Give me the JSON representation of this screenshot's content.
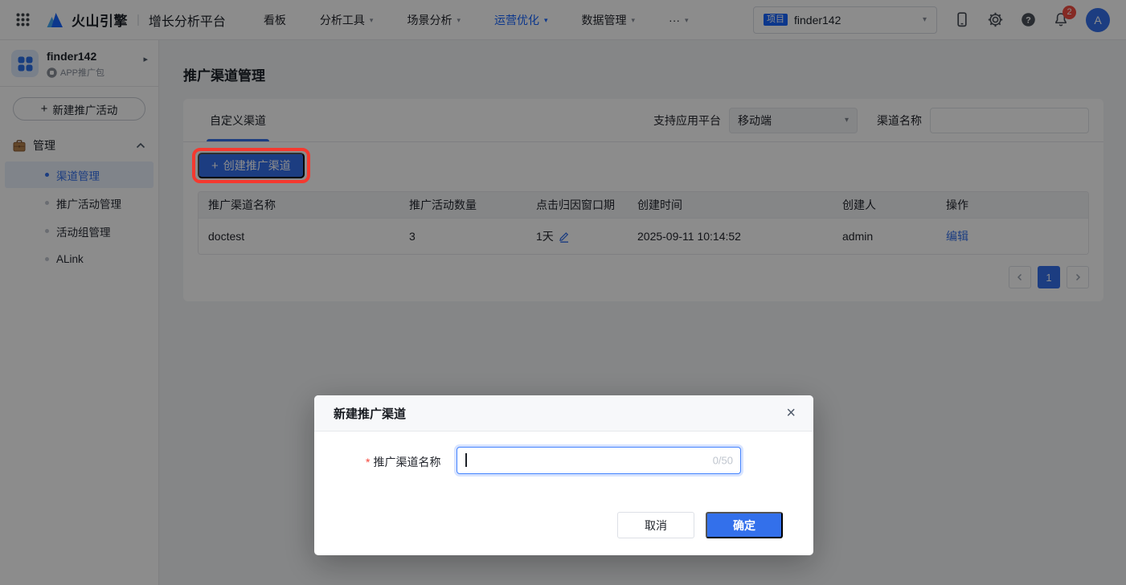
{
  "topbar": {
    "brand": "火山引擎",
    "product": "增长分析平台",
    "nav": [
      {
        "label": "看板"
      },
      {
        "label": "分析工具"
      },
      {
        "label": "场景分析"
      },
      {
        "label": "运营优化"
      },
      {
        "label": "数据管理"
      },
      {
        "label": "···"
      }
    ],
    "project_badge": "项目",
    "project_name": "finder142",
    "notification_count": "2",
    "avatar_letter": "A",
    "help_mark": "?"
  },
  "sidebar": {
    "workspace_name": "finder142",
    "workspace_type": "APP推广包",
    "new_campaign_label": "新建推广活动",
    "group_label": "管理",
    "items": [
      {
        "label": "渠道管理"
      },
      {
        "label": "推广活动管理"
      },
      {
        "label": "活动组管理"
      },
      {
        "label": "ALink"
      }
    ]
  },
  "main": {
    "page_title": "推广渠道管理",
    "tab_label": "自定义渠道",
    "platform_filter_label": "支持应用平台",
    "platform_filter_value": "移动端",
    "channel_filter_label": "渠道名称",
    "create_button_label": "创建推广渠道",
    "table": {
      "columns": [
        "推广渠道名称",
        "推广活动数量",
        "点击归因窗口期",
        "创建时间",
        "创建人",
        "操作"
      ],
      "rows": [
        {
          "name": "doctest",
          "campaign_count": "3",
          "attribution_window": "1天",
          "created_at": "2025-09-11 10:14:52",
          "creator": "admin",
          "action_label": "编辑"
        }
      ]
    },
    "pagination_current": "1"
  },
  "modal": {
    "title": "新建推广渠道",
    "required_mark": "*",
    "field_label": "推广渠道名称",
    "char_counter": "0/50",
    "cancel_label": "取消",
    "confirm_label": "确定"
  },
  "icons": {
    "plus": "+",
    "caret_down": "▾",
    "caret_right": "▸",
    "close": "×",
    "divider": "|"
  },
  "colors": {
    "primary": "#3370eb",
    "brand_blue": "#1664ff",
    "annotation_red": "#f5392f",
    "badge_red": "#f24d43"
  }
}
